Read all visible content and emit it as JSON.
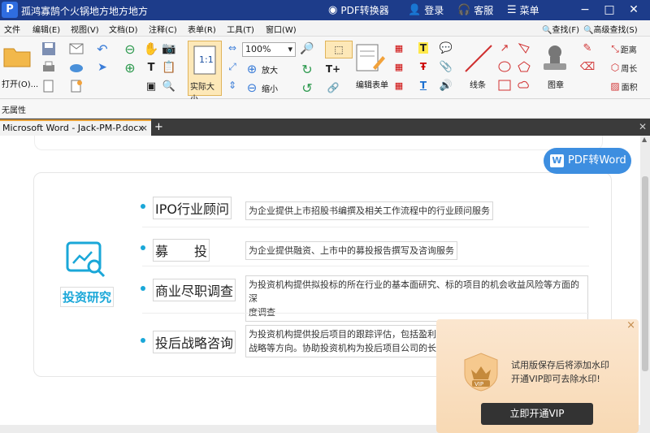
{
  "window": {
    "title": "孤鸿寡鹄个火锅地方地方地方",
    "logo_letter": "P",
    "pdf_converter": "PDF转换器",
    "login": "登录",
    "service": "客服",
    "menu": "菜单",
    "minimize": "−",
    "maximize": "□",
    "close": "✕"
  },
  "menubar": {
    "items": [
      "文件",
      "编辑(E)",
      "视图(V)",
      "文档(D)",
      "注释(C)",
      "表单(R)",
      "工具(T)",
      "窗口(W)"
    ],
    "find": "查找(F)",
    "advanced_find": "高级查找(S)"
  },
  "toolbar": {
    "open_label": "打开(O)...",
    "actual_size_label": "实际大小",
    "actual_size_icon_text": "1:1",
    "zoom_value": "100%",
    "zoom_in_label": "放大",
    "zoom_out_label": "缩小",
    "edit_form_label": "编辑表单",
    "line_label": "线条",
    "stamp_label": "图章",
    "distance_label": "距离",
    "perimeter_label": "周长",
    "area_label": "面积"
  },
  "propbar": {
    "label": "无属性"
  },
  "tab": {
    "label": "Microsoft Word - Jack-PM-P.docx",
    "close": "×",
    "add": "+"
  },
  "document": {
    "pdf_to_word": "PDF转Word",
    "pdf_to_word_icon": "W",
    "section_title": "投资研究",
    "rows": [
      {
        "name": "IPO行业顾问",
        "desc_lines": [
          "为企业提供上市招股书编撰及相关工作流程中的行业顾问服务"
        ]
      },
      {
        "name": "募　　投",
        "desc_lines": [
          "为企业提供融资、上市中的募投报告撰写及咨询服务"
        ]
      },
      {
        "name": "商业尽职调查",
        "desc_lines": [
          "为投资机构提供拟投标的所在行业的基本面研究、标的项目的机会收益风险等方面的深",
          "度调查"
        ]
      },
      {
        "name": "投后战略咨询",
        "desc_lines": [
          "为投资机构提供投后项目的跟踪评估，包括盈利能",
          "战略等方向。协助投资机构为投后项目公司的长期"
        ]
      }
    ]
  },
  "vip_popup": {
    "close": "×",
    "line1": "试用版保存后将添加水印",
    "line2": "开通VIP即可去除水印!",
    "button": "立即开通VIP",
    "badge": "VIP"
  }
}
